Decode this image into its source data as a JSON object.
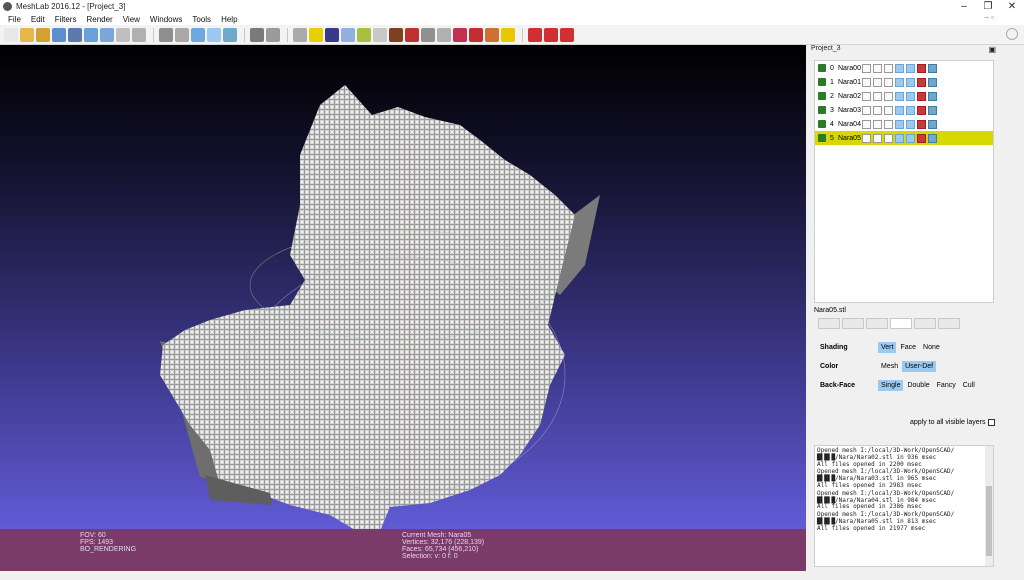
{
  "window": {
    "title": "MeshLab 2016.12 - [Project_3]",
    "controls": {
      "minimize": "–",
      "restore": "❐",
      "close": "✕"
    }
  },
  "menu": [
    "File",
    "Edit",
    "Filters",
    "Render",
    "View",
    "Windows",
    "Tools",
    "Help"
  ],
  "menu_mdi": "– ▫",
  "toolbar": {
    "groups": [
      [
        "new-icon",
        "open-icon",
        "open-project-icon",
        "reload-icon",
        "save-icon",
        "snapshot-icon",
        "bbox-icon",
        "points-icon",
        "wire-icon"
      ],
      [
        "hidden-lines-icon",
        "flat-lines-icon",
        "flat-icon",
        "smooth-icon",
        "texture-icon"
      ],
      [
        "layers-icon",
        "light-icon"
      ],
      [
        "trackball-icon",
        "about-icon",
        "color-icon",
        "measure-icon",
        "paint-icon",
        "select-icon",
        "paint-brush-icon",
        "z-paint-icon",
        "align-icon",
        "move-icon",
        "ref-icon",
        "quality-icon",
        "sample-icon",
        "info-icon"
      ],
      [
        "delete-vert-icon",
        "delete-face-icon",
        "delete-selection-icon"
      ]
    ]
  },
  "viewport": {
    "status_left": [
      "FOV: 60",
      "FPS:  1493",
      "BO_RENDERING"
    ],
    "status_mid": [
      "Current Mesh: Nara05",
      "Vertices: 32,176   (228,139)",
      "Faces: 65,734   (456,210)",
      "Selection: v: 0 f: 0"
    ]
  },
  "layer_panel": {
    "title": "Project_3",
    "float_icon": "float-icon",
    "layers": [
      {
        "index": "0",
        "name": "Nara00"
      },
      {
        "index": "1",
        "name": "Nara01"
      },
      {
        "index": "2",
        "name": "Nara02"
      },
      {
        "index": "3",
        "name": "Nara03"
      },
      {
        "index": "4",
        "name": "Nara04"
      },
      {
        "index": "5",
        "name": "Nara05",
        "selected": true
      }
    ]
  },
  "properties": {
    "mesh_title": "Nara05.stl",
    "shading": {
      "label": "Shading",
      "options": [
        "Vert",
        "Face",
        "None"
      ],
      "active": "Vert"
    },
    "color": {
      "label": "Color",
      "options": [
        "Mesh",
        "User-Def"
      ],
      "active": "User-Def"
    },
    "backface": {
      "label": "Back-Face",
      "options": [
        "Single",
        "Double",
        "Fancy",
        "Cull"
      ],
      "active": "Single"
    },
    "apply_label": "apply to all visible layers"
  },
  "log": [
    {
      "line1": "Opened mesh I:/local/3D-Work/OpenSCAD/",
      "line2": "█▌█▌█/Nara/Nara02.stl in 936 msec",
      "line3": "All files opened in 2200 msec"
    },
    {
      "line1": "Opened mesh I:/local/3D-Work/OpenSCAD/",
      "line2": "█▌█▌█/Nara/Nara03.stl in 965 msec",
      "line3": "All files opened in 2983 msec"
    },
    {
      "line1": "Opened mesh I:/local/3D-Work/OpenSCAD/",
      "line2": "█▌█▌█/Nara/Nara04.stl in 984 msec",
      "line3": "All files opened in 2386 msec"
    },
    {
      "line1": "Opened mesh I:/local/3D-Work/OpenSCAD/",
      "line2": "█▌█▌█/Nara/Nara05.stl in 813 msec",
      "line3": "All files opened in 21977 msec"
    }
  ],
  "colors": {
    "status_bar": "#7a3a6a",
    "selected_layer": "#d6d800",
    "active_option": "#9cc9f0",
    "mesh": "#bdbdbd"
  }
}
